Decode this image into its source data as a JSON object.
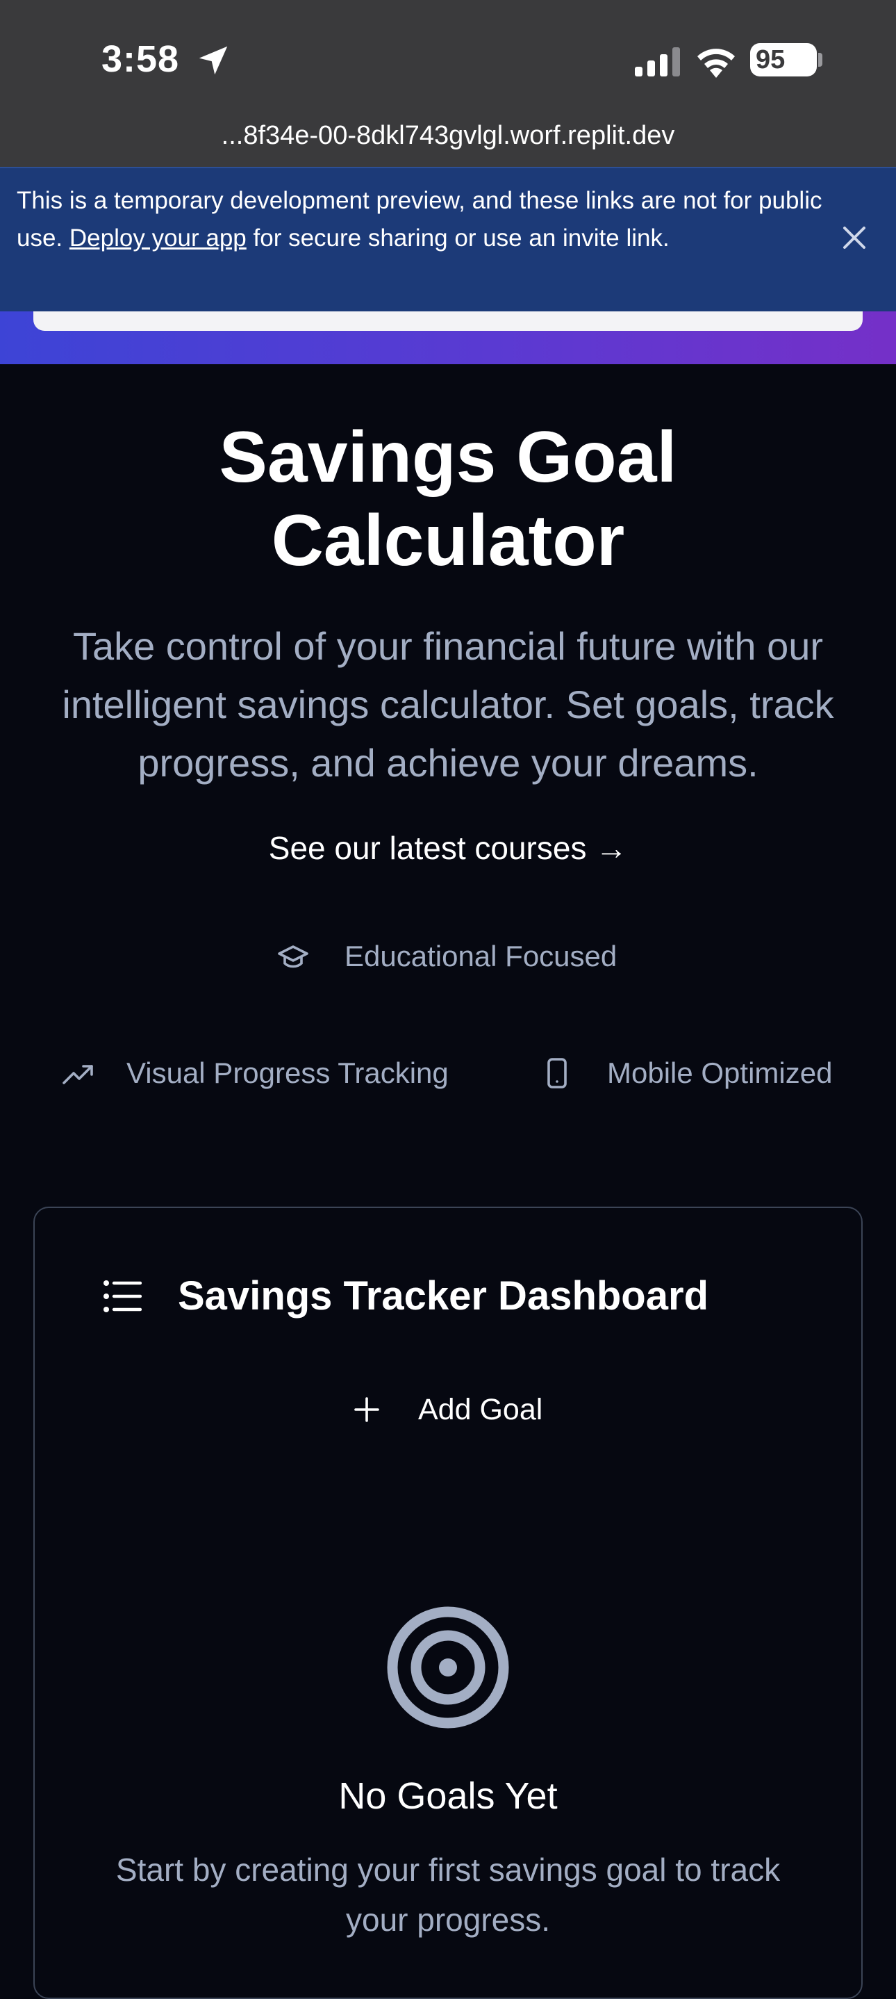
{
  "status_bar": {
    "time": "3:58",
    "battery": "95",
    "url": "...8f34e-00-8dkl743gvlgl.worf.replit.dev"
  },
  "dev_banner": {
    "text_before": "This is a temporary development preview, and these links are not for public use. ",
    "link_text": "Deploy your app",
    "text_after": " for secure sharing or use an invite link."
  },
  "hero": {
    "title": "Savings Goal Calculator",
    "subtitle": "Take control of your financial future with our intelligent savings calculator. Set goals, track progress, and achieve your dreams.",
    "courses_link": "See our latest courses →"
  },
  "features": [
    {
      "icon": "graduation-cap-icon",
      "label": "Educational Focused"
    },
    {
      "icon": "trending-up-icon",
      "label": "Visual Progress Tracking"
    },
    {
      "icon": "smartphone-icon",
      "label": "Mobile Optimized"
    }
  ],
  "dashboard": {
    "title": "Savings Tracker Dashboard",
    "add_goal_label": "Add Goal",
    "empty_title": "No Goals Yet",
    "empty_text": "Start by creating your first savings goal to track your progress."
  },
  "colors": {
    "page_background": "#060811",
    "banner_background": "#1c3a78",
    "muted_text": "#a3aec4",
    "gradient_start": "#3d44d6",
    "gradient_end": "#7530c8"
  }
}
